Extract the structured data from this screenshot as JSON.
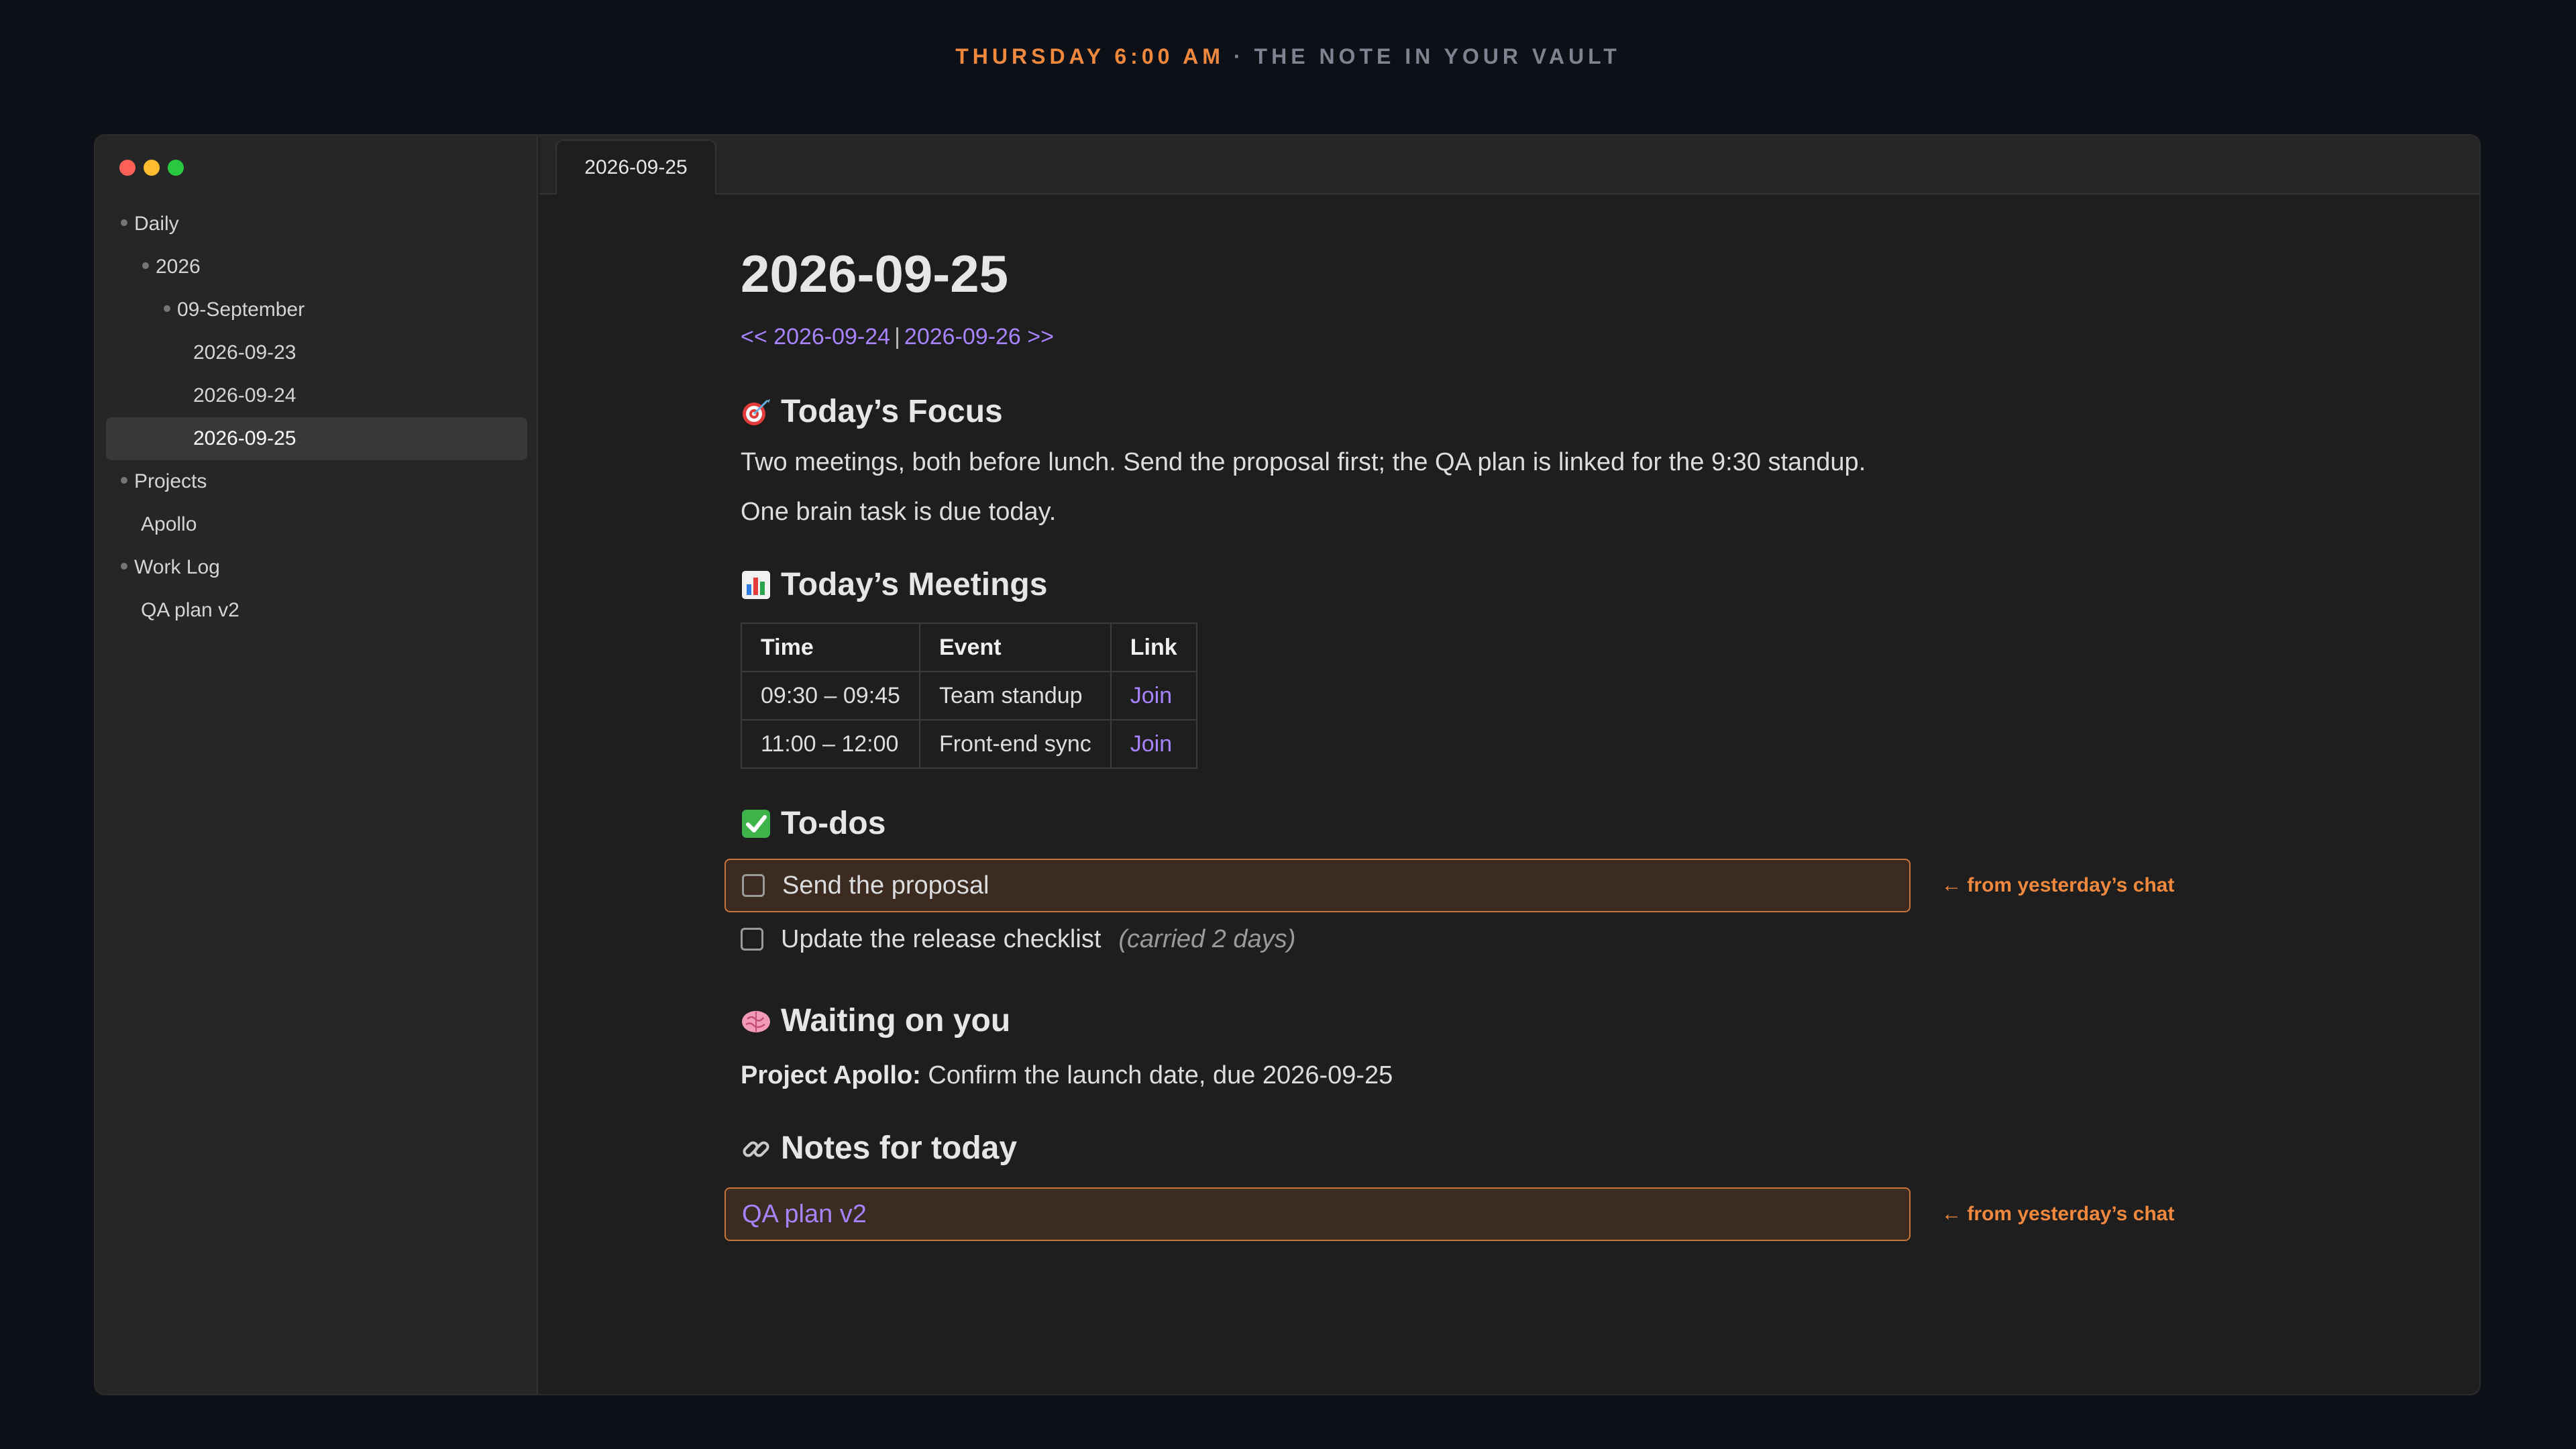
{
  "banner": {
    "accent": "Thursday 6:00 AM",
    "separator": "·",
    "rest": "The note in your vault"
  },
  "sidebar": {
    "items": [
      {
        "label": "Daily",
        "level": 0,
        "type": "folder"
      },
      {
        "label": "2026",
        "level": 1,
        "type": "folder"
      },
      {
        "label": "09-September",
        "level": 2,
        "type": "folder"
      },
      {
        "label": "2026-09-23",
        "level": 3,
        "type": "file"
      },
      {
        "label": "2026-09-24",
        "level": 3,
        "type": "file"
      },
      {
        "label": "2026-09-25",
        "level": 3,
        "type": "file",
        "active": true
      },
      {
        "label": "Projects",
        "level": 0,
        "type": "folder"
      },
      {
        "label": "Apollo",
        "level": 1,
        "type": "file"
      },
      {
        "label": "Work Log",
        "level": 0,
        "type": "folder"
      },
      {
        "label": "QA plan v2",
        "level": 1,
        "type": "file"
      }
    ]
  },
  "tab": {
    "label": "2026-09-25"
  },
  "note": {
    "title": "2026-09-25",
    "nav": {
      "prev": "<< 2026-09-24",
      "divider": "|",
      "next": "2026-09-26 >>"
    },
    "focus": {
      "heading": "Today’s Focus",
      "icon": "target-icon",
      "line1": "Two meetings, both before lunch. Send the proposal first; the QA plan is linked for the 9:30 standup.",
      "line2": "One brain task is due today."
    },
    "meetings": {
      "heading": "Today’s Meetings",
      "icon": "bar-chart-icon",
      "columns": [
        "Time",
        "Event",
        "Link"
      ],
      "rows": [
        {
          "time": "09:30 – 09:45",
          "event": "Team standup",
          "link": "Join"
        },
        {
          "time": "11:00 – 12:00",
          "event": "Front-end sync",
          "link": "Join"
        }
      ]
    },
    "todos": {
      "heading": "To-dos",
      "icon": "check-mark-icon",
      "items": [
        {
          "text": "Send the proposal",
          "note": "",
          "annotation": "← from yesterday’s chat",
          "checked": false
        },
        {
          "text": "Update the release checklist",
          "note": "(carried 2 days)",
          "annotation": "",
          "checked": false
        }
      ]
    },
    "waiting": {
      "heading": "Waiting on you",
      "icon": "brain-icon",
      "label": "Project Apollo:",
      "text": "Confirm the launch date, due 2026-09-25"
    },
    "notes": {
      "heading": "Notes for today",
      "icon": "link-icon",
      "link": "QA plan v2",
      "annotation": "← from yesterday’s chat"
    }
  },
  "colors": {
    "accent": "#f0883e",
    "link": "#a882ff",
    "highlight_bg": "#3c2b21",
    "highlight_border": "#c9743a"
  }
}
